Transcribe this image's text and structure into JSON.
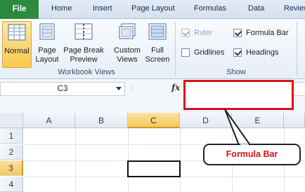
{
  "tabs": [
    "File",
    "Home",
    "Insert",
    "Page Layout",
    "Formulas",
    "Data",
    "Review"
  ],
  "workbook_views": {
    "title": "Workbook Views",
    "buttons": [
      {
        "line1": "Normal",
        "line2": ""
      },
      {
        "line1": "Page",
        "line2": "Layout"
      },
      {
        "line1": "Page Break",
        "line2": "Preview"
      },
      {
        "line1": "Custom",
        "line2": "Views"
      },
      {
        "line1": "Full",
        "line2": "Screen"
      }
    ]
  },
  "show": {
    "title": "Show",
    "ruler": "Ruler",
    "gridlines": "Gridlines",
    "formula_bar": "Formula Bar",
    "headings": "Headings"
  },
  "formula_bar": {
    "name_box": "C3",
    "fx": "fx",
    "value": ""
  },
  "grid": {
    "columns": [
      "A",
      "B",
      "C",
      "D",
      "E"
    ],
    "rows": [
      "1",
      "2",
      "3",
      "4"
    ],
    "active_column": "C",
    "active_row": "3"
  },
  "callout": {
    "label": "Formula Bar"
  },
  "colors": {
    "file_tab": "#2b8a3e",
    "highlight": "#d7141b",
    "selection": "#f8c94e"
  }
}
